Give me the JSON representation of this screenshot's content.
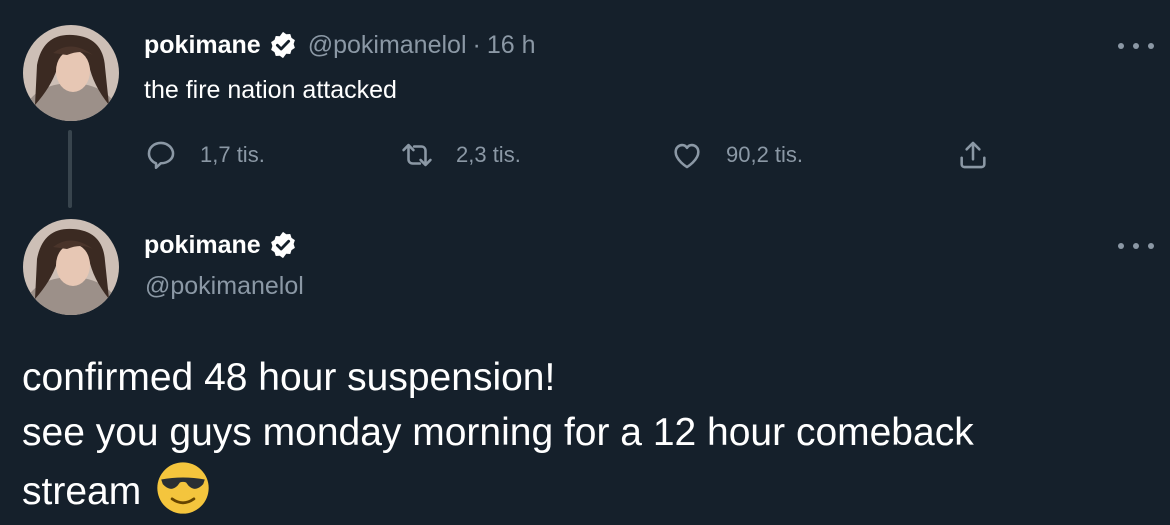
{
  "tweet1": {
    "display_name": "pokimane",
    "handle": "@pokimanelol",
    "separator": "·",
    "time": "16 h",
    "text": "the fire nation attacked",
    "actions": {
      "reply_count": "1,7 tis.",
      "retweet_count": "2,3 tis.",
      "like_count": "90,2 tis."
    }
  },
  "tweet2": {
    "display_name": "pokimane",
    "handle": "@pokimanelol",
    "text_lines": [
      "confirmed 48 hour suspension!",
      "see you guys monday morning for a 12 hour comeback",
      "stream"
    ],
    "emoji": "sunglasses-face-emoji"
  },
  "colors": {
    "background": "#15202b",
    "primary_text": "#ffffff",
    "secondary_text": "#8b98a5",
    "thread_line": "#38444d"
  },
  "icons": [
    "verified-badge-icon",
    "reply-icon",
    "retweet-icon",
    "like-icon",
    "share-icon",
    "more-options-icon"
  ]
}
